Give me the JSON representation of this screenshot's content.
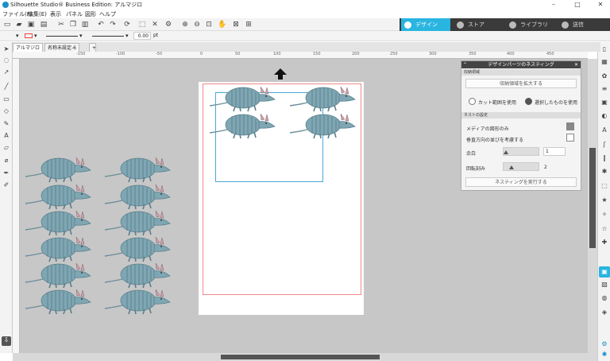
{
  "window": {
    "title": "Silhouette Studio® Business Edition: アルマジロ",
    "minimize": "–",
    "maximize": "□",
    "close": "✕"
  },
  "menu": [
    "ファイル(F)",
    "編集(E)",
    "表示",
    "パネル",
    "図形",
    "ヘルプ"
  ],
  "nav_tabs": [
    {
      "label": "デザイン",
      "active": true
    },
    {
      "label": "ストア",
      "active": false
    },
    {
      "label": "ライブラリ",
      "active": false
    },
    {
      "label": "送信",
      "active": false
    }
  ],
  "properties": {
    "line_width_value": "0.00",
    "unit": "pt"
  },
  "doc_tabs": [
    {
      "label": "アルマジロ",
      "active": true
    },
    {
      "label": "名称未設定-6",
      "active": false
    }
  ],
  "add_tab": "+",
  "ruler_ticks": [
    "-150",
    "-100",
    "-50",
    "0",
    "50",
    "100",
    "150",
    "200",
    "250",
    "300",
    "350",
    "400",
    "450"
  ],
  "nesting_panel": {
    "title": "デザインパーツのネスティング",
    "section_area": "収納領域",
    "expand_button": "収納領域を拡大する",
    "radio_cut_area": "カット範囲を使用",
    "radio_selected": "選択したものを使用",
    "radio_selected_value": "selected",
    "section_options": "ネストの設定",
    "media_shapes_only": "メディアの図形のみ",
    "media_shapes_only_checked": true,
    "vertical_order": "垂直方向の並びを考慮する",
    "vertical_order_checked": false,
    "padding_label": "余白",
    "padding_value": "1",
    "padding_level": 0.0,
    "rotation_label": "回転刻み",
    "rotation_value": "2",
    "rotation_level": 0.15,
    "run_button": "ネスティングを実行する"
  },
  "colors": {
    "accent": "#29b5e0",
    "armadillo_body": "#7fa7b3",
    "armadillo_outline": "#5a7f8c"
  }
}
